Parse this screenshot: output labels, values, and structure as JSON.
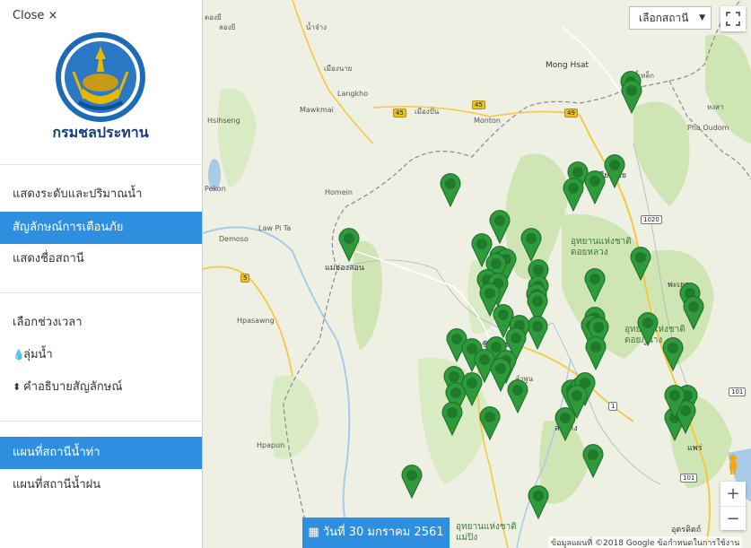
{
  "sidebar": {
    "close_label": "Close ×",
    "logo_text": "กรมชลประทาน",
    "menu_top": [
      {
        "label": "แสดงระดับและปริมาณน้ำ"
      },
      {
        "label": "สัญลักษณ์การเตือนภัย"
      },
      {
        "label": "แสดงชื่อสถานี"
      }
    ],
    "period_label": "เลือกช่วงเวลา",
    "basin_label": "ลุ่มน้ำ",
    "legend_label": "คำอธิบายสัญลักษณ์",
    "menu_bottom": [
      {
        "label": "แผนที่สถานีน้ำท่า"
      },
      {
        "label": "แผนที่สถานีน้ำฝน"
      }
    ]
  },
  "map": {
    "station_select": "เลือกสถานี",
    "date_label": "วันที่ 30 มกราคม 2561",
    "attribution": "ข้อมูลแผนที่ ©2018 Google   ข้อกำหนดในการใช้งาน",
    "zoom_in": "+",
    "zoom_out": "−",
    "pin_color": "#2e9a3c",
    "places": [
      {
        "name": "ตองยี"
      },
      {
        "name": "ลองยี"
      },
      {
        "name": "น้ำจ๋าง"
      },
      {
        "name": "เมืองนาย"
      },
      {
        "name": "Langkho"
      },
      {
        "name": "Mawkmai"
      },
      {
        "name": "เมืองปั่น"
      },
      {
        "name": "Mong Hsat"
      },
      {
        "name": "Monton"
      },
      {
        "name": "ท่าขี้เหล็ก"
      },
      {
        "name": "หงสา"
      },
      {
        "name": "Pha Oudom"
      },
      {
        "name": "Hsihseng"
      },
      {
        "name": "Pekon"
      },
      {
        "name": "Homein"
      },
      {
        "name": "Law Pi Ta"
      },
      {
        "name": "Demoso"
      },
      {
        "name": "Hpasawng"
      },
      {
        "name": "แม่ฮ่องสอน"
      },
      {
        "name": "เชียงราย"
      },
      {
        "name": "อุทยานแห่งชาติ ดอยหลวง"
      },
      {
        "name": "พะเยา"
      },
      {
        "name": "อุทยานแห่งชาติ ดอยภูนาง"
      },
      {
        "name": "เชียงใหม่"
      },
      {
        "name": "ลำพูน"
      },
      {
        "name": "ลำปาง"
      },
      {
        "name": "แพร่"
      },
      {
        "name": "Hpapun"
      },
      {
        "name": "อุตรดิตถ์"
      },
      {
        "name": "อุทยานแห่งชาติ แม่ปิง"
      }
    ],
    "road_shields": [
      "45",
      "45",
      "49",
      "1020",
      "5",
      "101",
      "101",
      "1"
    ]
  }
}
